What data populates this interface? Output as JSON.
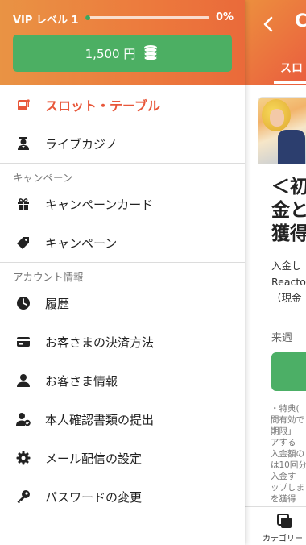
{
  "vip": {
    "label": "VIP レベル 1",
    "percent_text": "0%",
    "progress": 0.0
  },
  "balance": {
    "amount": "1,500 円"
  },
  "menu": {
    "main": [
      {
        "label": "スロット・テーブル",
        "icon": "slot-machine-icon",
        "active": true
      },
      {
        "label": "ライブカジノ",
        "icon": "dealer-icon",
        "active": false
      }
    ],
    "campaign_title": "キャンペーン",
    "campaign": [
      {
        "label": "キャンペーンカード",
        "icon": "gift-icon"
      },
      {
        "label": "キャンペーン",
        "icon": "tag-icon"
      }
    ],
    "account_title": "アカウント情報",
    "account": [
      {
        "label": "履歴",
        "icon": "clock-icon"
      },
      {
        "label": "お客さまの決済方法",
        "icon": "credit-card-icon"
      },
      {
        "label": "お客さま情報",
        "icon": "person-icon"
      },
      {
        "label": "本人確認書類の提出",
        "icon": "person-check-icon"
      },
      {
        "label": "メール配信の設定",
        "icon": "gear-icon"
      },
      {
        "label": "パスワードの変更",
        "icon": "key-icon"
      }
    ]
  },
  "background": {
    "partial_header_char": "C",
    "tab_label": "スロ",
    "title": "＜初\n金と\n獲得",
    "body": "入金し\nReacto\n（現金",
    "next_week": "来週",
    "fine_print": "・特典(\n間有効で\n期限」\nアする\n入金額の\nは10回分\n入金す\nップしま\nを獲得",
    "bottom_label": "カテゴリー"
  },
  "colors": {
    "accent": "#e8573a",
    "green": "#4caf63",
    "header_start": "#e99344",
    "header_end": "#ea6a3a"
  }
}
